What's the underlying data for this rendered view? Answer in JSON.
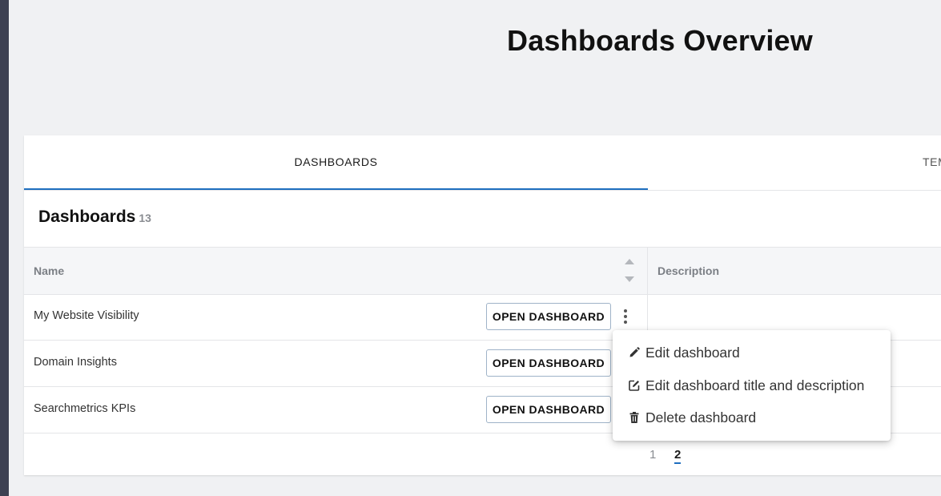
{
  "page": {
    "title": "Dashboards Overview"
  },
  "tabs": [
    {
      "label": "DASHBOARDS",
      "active": true
    },
    {
      "label": "TEM",
      "active": false
    }
  ],
  "section": {
    "title": "Dashboards",
    "count": "13"
  },
  "table": {
    "columns": [
      "Name",
      "Description"
    ],
    "rows": [
      {
        "name": "My Website Visibility",
        "action": "OPEN DASHBOARD"
      },
      {
        "name": "Domain Insights",
        "action": "OPEN DASHBOARD"
      },
      {
        "name": "Searchmetrics KPIs",
        "action": "OPEN DASHBOARD"
      }
    ]
  },
  "pagination": {
    "pages": [
      "1",
      "2"
    ],
    "current": "2"
  },
  "context_menu": {
    "items": [
      {
        "label": "Edit dashboard",
        "icon": "pencil-icon"
      },
      {
        "label": "Edit dashboard title and description",
        "icon": "edit-square-icon"
      },
      {
        "label": "Delete dashboard",
        "icon": "trash-icon"
      }
    ]
  },
  "colors": {
    "accent": "#1f6fbf",
    "sidebar": "#3d4152",
    "background": "#f0f1f3"
  }
}
